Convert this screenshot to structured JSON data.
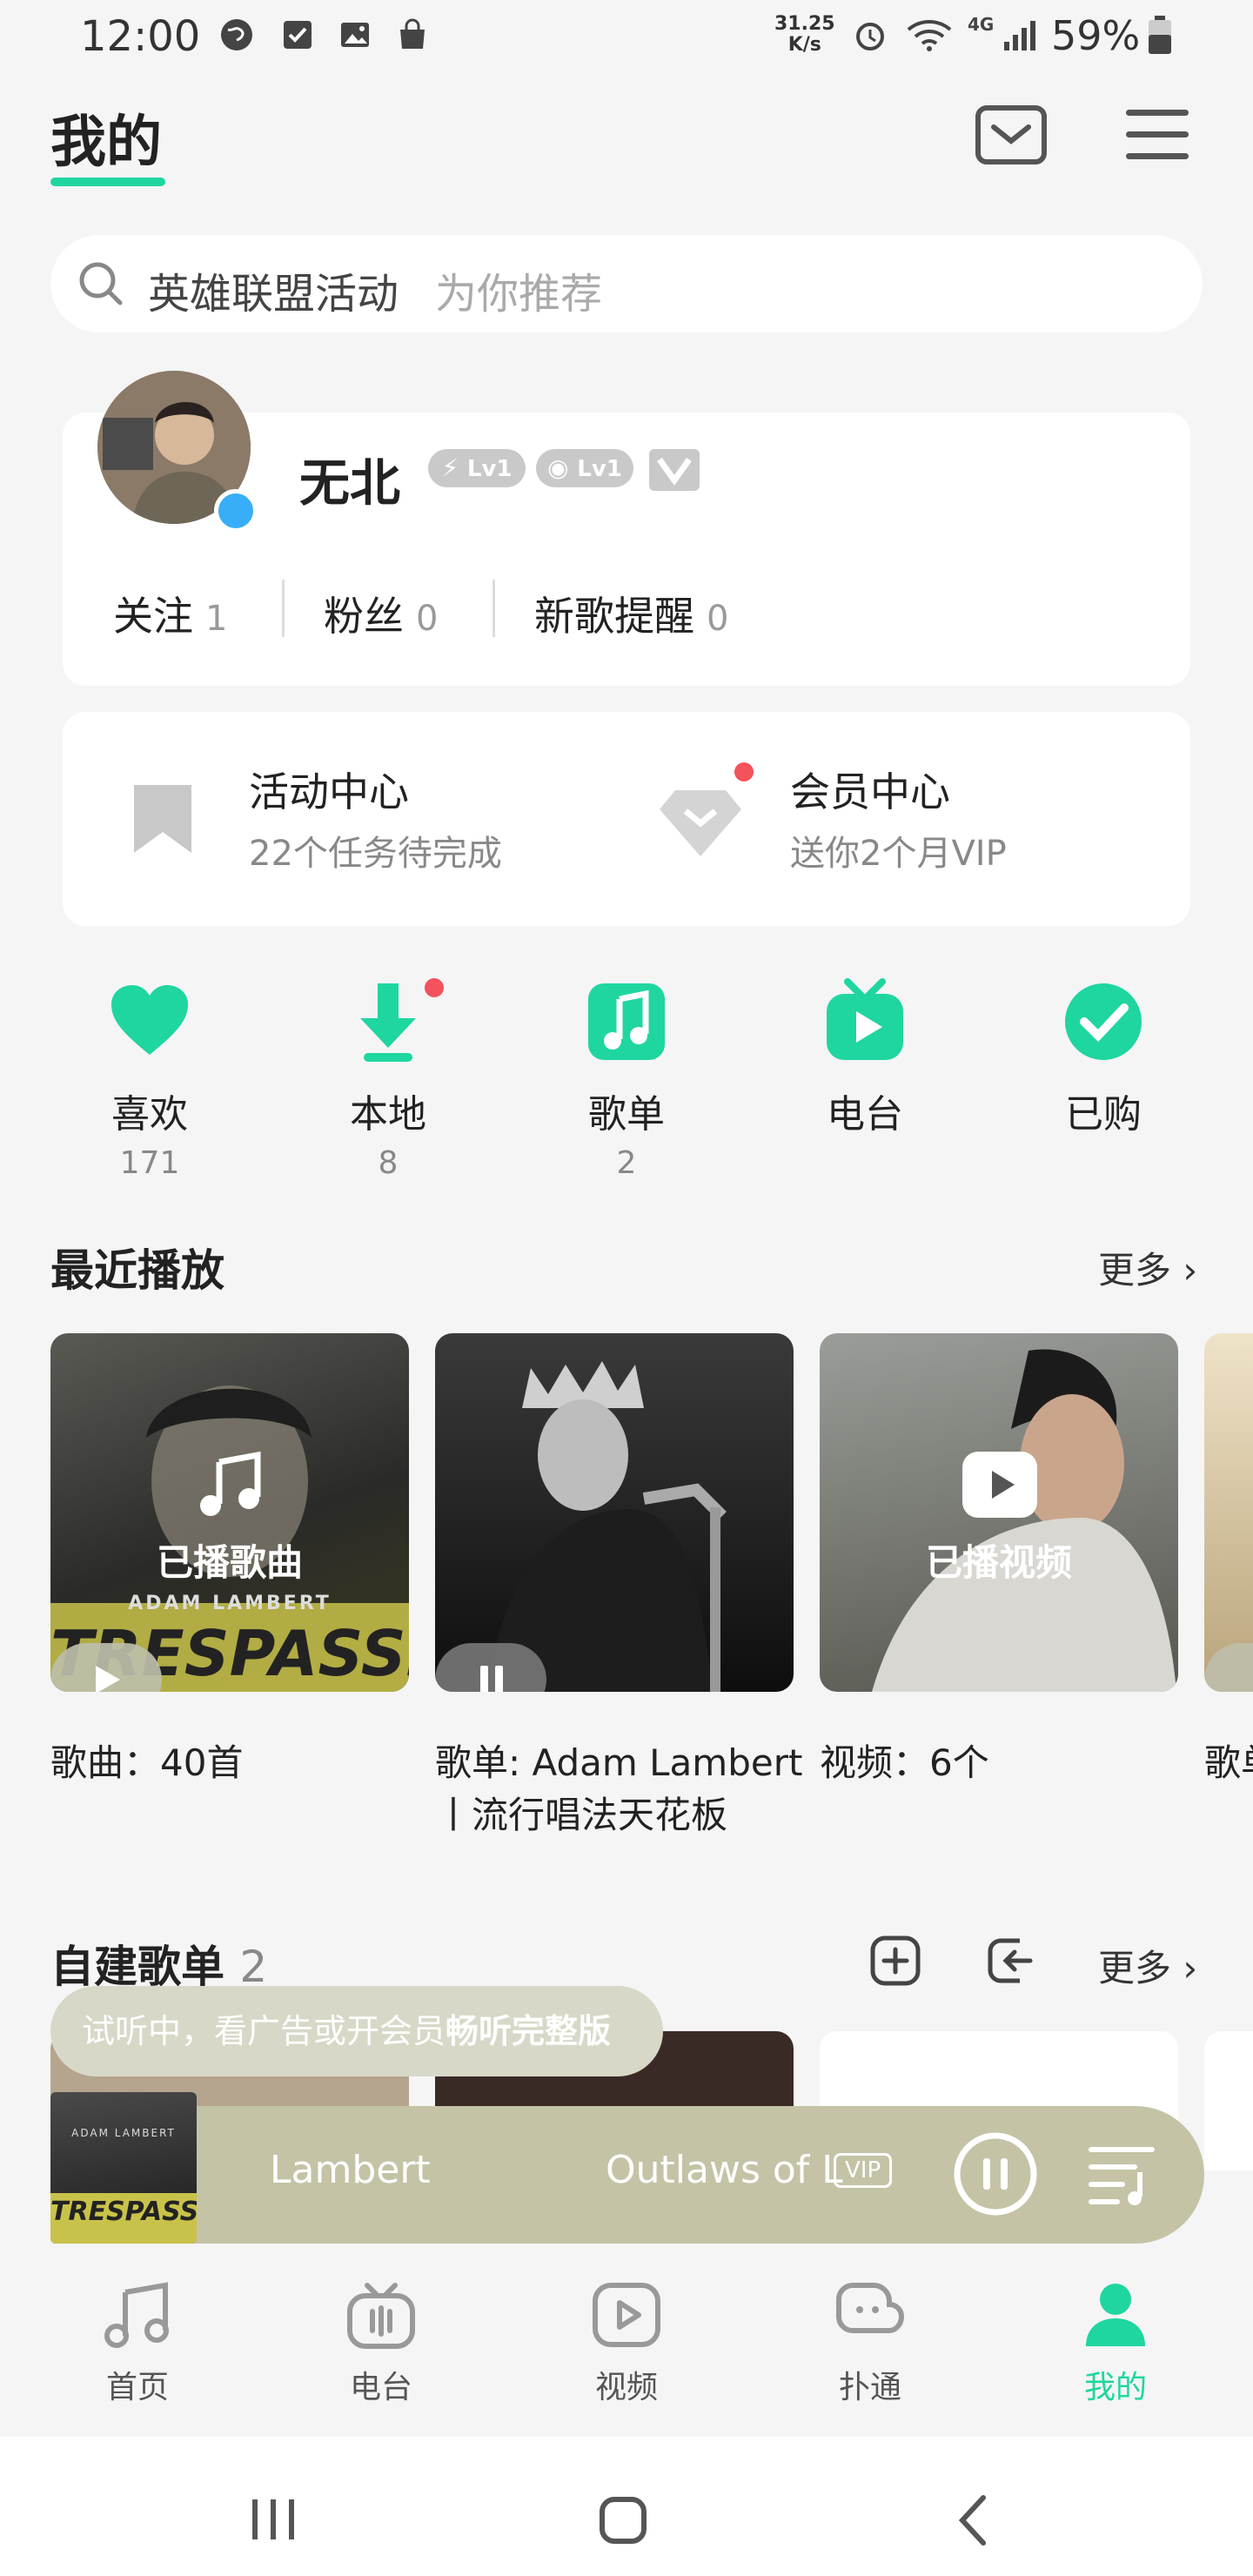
{
  "status_bar": {
    "time": "12:00",
    "speed": "31.25\nK/s",
    "network": "4G",
    "battery": "59%"
  },
  "header": {
    "title": "我的"
  },
  "search": {
    "query": "英雄联盟活动",
    "hint": "为你推荐"
  },
  "profile": {
    "username": "无北",
    "badges": [
      "Lv1",
      "Lv1"
    ],
    "stats": [
      {
        "label": "关注",
        "value": "1"
      },
      {
        "label": "粉丝",
        "value": "0"
      },
      {
        "label": "新歌提醒",
        "value": "0"
      }
    ]
  },
  "activities": [
    {
      "title": "活动中心",
      "subtitle": "22个任务待完成"
    },
    {
      "title": "会员中心",
      "subtitle": "送你2个月VIP"
    }
  ],
  "quick_access": [
    {
      "label": "喜欢",
      "count": "171",
      "icon": "heart-icon"
    },
    {
      "label": "本地",
      "count": "8",
      "icon": "download-icon"
    },
    {
      "label": "歌单",
      "count": "2",
      "icon": "music-note-icon"
    },
    {
      "label": "电台",
      "count": "",
      "icon": "radio-tv-icon"
    },
    {
      "label": "已购",
      "count": "",
      "icon": "check-circle-icon"
    }
  ],
  "recent": {
    "title": "最近播放",
    "more": "更多",
    "tiles": [
      {
        "overlay": "已播歌曲",
        "caption": "歌曲：40首",
        "album_text_1": "ADAM LAMBERT",
        "album_text_2": "TRESPASSING"
      },
      {
        "overlay": "",
        "caption_line1": "歌单: Adam Lambert",
        "caption_line2": "丨流行唱法天花板"
      },
      {
        "overlay": "已播视频",
        "caption": "视频：6个"
      },
      {
        "caption": "歌单"
      }
    ]
  },
  "custom_playlists": {
    "title": "自建歌单",
    "count": "2",
    "more": "更多"
  },
  "toast": {
    "text": "试听中，看广告或开会员",
    "highlight": "畅听完整版"
  },
  "player": {
    "artist": "Lambert",
    "song": "Outlaws of L",
    "vip": "VIP",
    "cover_text_1": "ADAM LAMBERT",
    "cover_text_2": "TRESPASSING"
  },
  "tabs": [
    {
      "label": "首页",
      "icon": "music-note-icon"
    },
    {
      "label": "电台",
      "icon": "radio-icon"
    },
    {
      "label": "视频",
      "icon": "video-play-icon"
    },
    {
      "label": "扑通",
      "icon": "chat-bubble-icon"
    },
    {
      "label": "我的",
      "icon": "person-icon",
      "active": true
    }
  ],
  "colors": {
    "accent": "#1fd6a0",
    "reddot": "#f4525c",
    "player_bg": "#c4c3a6"
  }
}
